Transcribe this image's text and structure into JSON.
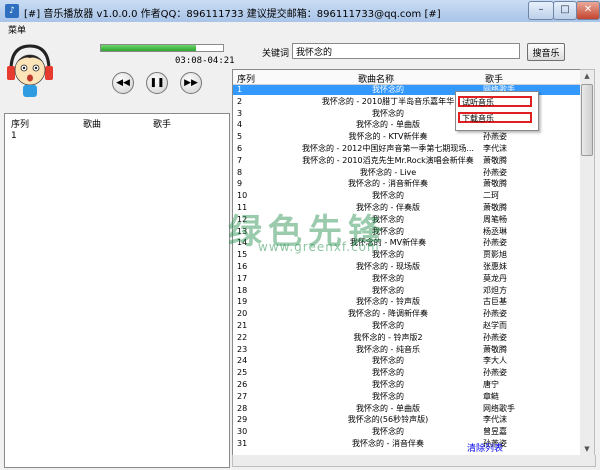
{
  "window": {
    "title": "[#] 音乐播放器 v1.0.0.0   作者QQ：896111733 建议提交邮箱：896111733@qq.com [#]",
    "minimize": "–",
    "maximize": "□",
    "close": "✕"
  },
  "menu": {
    "label": "菜单"
  },
  "player": {
    "progress_percent": 78,
    "time": "03:08-04:21",
    "prev": "◀◀",
    "pause": "❚❚",
    "next": "▶▶"
  },
  "search": {
    "label": "关键词",
    "value": "我怀念的",
    "button": "搜音乐"
  },
  "playlist": {
    "headers": {
      "no": "序列",
      "song": "歌曲",
      "singer": "歌手"
    },
    "rows": [
      {
        "no": "1"
      }
    ]
  },
  "results": {
    "headers": {
      "no": "序列",
      "name": "歌曲名称",
      "singer": "歌手"
    },
    "rows": [
      {
        "no": "1",
        "name": "我怀念的",
        "singer": "网络歌手"
      },
      {
        "no": "2",
        "name": "我怀念的 - 2010腊丁半岛音乐嘉年华",
        "singer": ""
      },
      {
        "no": "3",
        "name": "我怀念的",
        "singer": ""
      },
      {
        "no": "4",
        "name": "我怀念的 - 单曲版",
        "singer": "四曲哥"
      },
      {
        "no": "5",
        "name": "我怀念的 - KTV新伴奏",
        "singer": "孙燕姿"
      },
      {
        "no": "6",
        "name": "我怀念的 - 2012中国好声音第一季第七期现场...",
        "singer": "李代沫"
      },
      {
        "no": "7",
        "name": "我怀念的 - 2010滔克先生Mr.Rock演唱会新伴奏",
        "singer": "萧敬腾"
      },
      {
        "no": "8",
        "name": "我怀念的 - Live",
        "singer": "孙燕姿"
      },
      {
        "no": "9",
        "name": "我怀念的 - 消音新伴奏",
        "singer": "萧敬腾"
      },
      {
        "no": "10",
        "name": "我怀念的",
        "singer": "二珂"
      },
      {
        "no": "11",
        "name": "我怀念的 - 伴奏版",
        "singer": "萧敬腾"
      },
      {
        "no": "12",
        "name": "我怀念的",
        "singer": "周笔畅"
      },
      {
        "no": "13",
        "name": "我怀念的",
        "singer": "杨丞琳"
      },
      {
        "no": "14",
        "name": "我怀念的 - MV新伴奏",
        "singer": "孙燕姿"
      },
      {
        "no": "15",
        "name": "我怀念的",
        "singer": "贾影旭"
      },
      {
        "no": "16",
        "name": "我怀念的 - 现场版",
        "singer": "张惠妹"
      },
      {
        "no": "17",
        "name": "我怀念的",
        "singer": "莫龙丹"
      },
      {
        "no": "18",
        "name": "我怀念的",
        "singer": "邓炟方"
      },
      {
        "no": "19",
        "name": "我怀念的 - 铃声版",
        "singer": "古巨基"
      },
      {
        "no": "20",
        "name": "我怀念的 - 降调新伴奏",
        "singer": "孙燕姿"
      },
      {
        "no": "21",
        "name": "我怀念的",
        "singer": "赵学而"
      },
      {
        "no": "22",
        "name": "我怀念的 - 铃声版2",
        "singer": "孙燕姿"
      },
      {
        "no": "23",
        "name": "我怀念的 - 纯音乐",
        "singer": "萧敬腾"
      },
      {
        "no": "24",
        "name": "我怀念的",
        "singer": "李大人"
      },
      {
        "no": "25",
        "name": "我怀念的",
        "singer": "孙燕姿"
      },
      {
        "no": "26",
        "name": "我怀念的",
        "singer": "唐宁"
      },
      {
        "no": "27",
        "name": "我怀念的",
        "singer": "章鲢"
      },
      {
        "no": "28",
        "name": "我怀念的 - 单曲版",
        "singer": "网络歌手"
      },
      {
        "no": "29",
        "name": "我怀念的(56秒铃声版)",
        "singer": "李代沫"
      },
      {
        "no": "30",
        "name": "我怀念的",
        "singer": "曾昱嘉"
      },
      {
        "no": "31",
        "name": "我怀念的 - 消音伴奏",
        "singer": "孙燕姿"
      }
    ]
  },
  "context_menu": {
    "items": [
      "试听音乐",
      "下载音乐"
    ],
    "highlight_color": "#e02020"
  },
  "watermark": {
    "text": "绿色先锋",
    "url": "www.greenxf.com"
  },
  "status": {
    "link": "清除列表"
  },
  "colors": {
    "selection": "#3399ff",
    "progress": "#2ea62e"
  }
}
